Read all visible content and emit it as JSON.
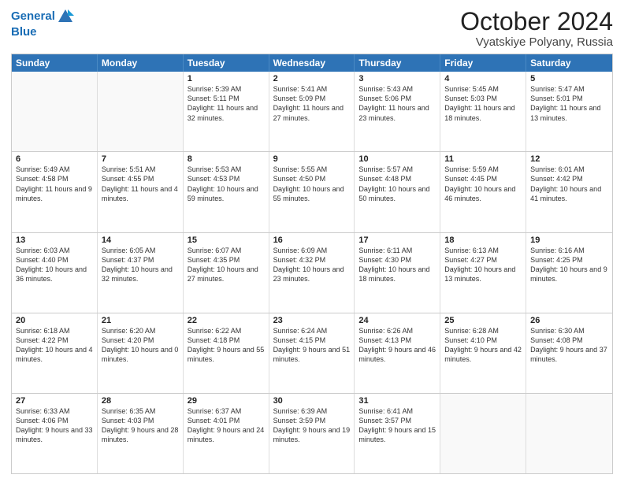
{
  "logo": {
    "line1": "General",
    "line2": "Blue"
  },
  "title": {
    "month": "October 2024",
    "location": "Vyatskiye Polyany, Russia"
  },
  "header_days": [
    "Sunday",
    "Monday",
    "Tuesday",
    "Wednesday",
    "Thursday",
    "Friday",
    "Saturday"
  ],
  "weeks": [
    [
      {
        "day": "",
        "sunrise": "",
        "sunset": "",
        "daylight": ""
      },
      {
        "day": "",
        "sunrise": "",
        "sunset": "",
        "daylight": ""
      },
      {
        "day": "1",
        "sunrise": "Sunrise: 5:39 AM",
        "sunset": "Sunset: 5:11 PM",
        "daylight": "Daylight: 11 hours and 32 minutes."
      },
      {
        "day": "2",
        "sunrise": "Sunrise: 5:41 AM",
        "sunset": "Sunset: 5:09 PM",
        "daylight": "Daylight: 11 hours and 27 minutes."
      },
      {
        "day": "3",
        "sunrise": "Sunrise: 5:43 AM",
        "sunset": "Sunset: 5:06 PM",
        "daylight": "Daylight: 11 hours and 23 minutes."
      },
      {
        "day": "4",
        "sunrise": "Sunrise: 5:45 AM",
        "sunset": "Sunset: 5:03 PM",
        "daylight": "Daylight: 11 hours and 18 minutes."
      },
      {
        "day": "5",
        "sunrise": "Sunrise: 5:47 AM",
        "sunset": "Sunset: 5:01 PM",
        "daylight": "Daylight: 11 hours and 13 minutes."
      }
    ],
    [
      {
        "day": "6",
        "sunrise": "Sunrise: 5:49 AM",
        "sunset": "Sunset: 4:58 PM",
        "daylight": "Daylight: 11 hours and 9 minutes."
      },
      {
        "day": "7",
        "sunrise": "Sunrise: 5:51 AM",
        "sunset": "Sunset: 4:55 PM",
        "daylight": "Daylight: 11 hours and 4 minutes."
      },
      {
        "day": "8",
        "sunrise": "Sunrise: 5:53 AM",
        "sunset": "Sunset: 4:53 PM",
        "daylight": "Daylight: 10 hours and 59 minutes."
      },
      {
        "day": "9",
        "sunrise": "Sunrise: 5:55 AM",
        "sunset": "Sunset: 4:50 PM",
        "daylight": "Daylight: 10 hours and 55 minutes."
      },
      {
        "day": "10",
        "sunrise": "Sunrise: 5:57 AM",
        "sunset": "Sunset: 4:48 PM",
        "daylight": "Daylight: 10 hours and 50 minutes."
      },
      {
        "day": "11",
        "sunrise": "Sunrise: 5:59 AM",
        "sunset": "Sunset: 4:45 PM",
        "daylight": "Daylight: 10 hours and 46 minutes."
      },
      {
        "day": "12",
        "sunrise": "Sunrise: 6:01 AM",
        "sunset": "Sunset: 4:42 PM",
        "daylight": "Daylight: 10 hours and 41 minutes."
      }
    ],
    [
      {
        "day": "13",
        "sunrise": "Sunrise: 6:03 AM",
        "sunset": "Sunset: 4:40 PM",
        "daylight": "Daylight: 10 hours and 36 minutes."
      },
      {
        "day": "14",
        "sunrise": "Sunrise: 6:05 AM",
        "sunset": "Sunset: 4:37 PM",
        "daylight": "Daylight: 10 hours and 32 minutes."
      },
      {
        "day": "15",
        "sunrise": "Sunrise: 6:07 AM",
        "sunset": "Sunset: 4:35 PM",
        "daylight": "Daylight: 10 hours and 27 minutes."
      },
      {
        "day": "16",
        "sunrise": "Sunrise: 6:09 AM",
        "sunset": "Sunset: 4:32 PM",
        "daylight": "Daylight: 10 hours and 23 minutes."
      },
      {
        "day": "17",
        "sunrise": "Sunrise: 6:11 AM",
        "sunset": "Sunset: 4:30 PM",
        "daylight": "Daylight: 10 hours and 18 minutes."
      },
      {
        "day": "18",
        "sunrise": "Sunrise: 6:13 AM",
        "sunset": "Sunset: 4:27 PM",
        "daylight": "Daylight: 10 hours and 13 minutes."
      },
      {
        "day": "19",
        "sunrise": "Sunrise: 6:16 AM",
        "sunset": "Sunset: 4:25 PM",
        "daylight": "Daylight: 10 hours and 9 minutes."
      }
    ],
    [
      {
        "day": "20",
        "sunrise": "Sunrise: 6:18 AM",
        "sunset": "Sunset: 4:22 PM",
        "daylight": "Daylight: 10 hours and 4 minutes."
      },
      {
        "day": "21",
        "sunrise": "Sunrise: 6:20 AM",
        "sunset": "Sunset: 4:20 PM",
        "daylight": "Daylight: 10 hours and 0 minutes."
      },
      {
        "day": "22",
        "sunrise": "Sunrise: 6:22 AM",
        "sunset": "Sunset: 4:18 PM",
        "daylight": "Daylight: 9 hours and 55 minutes."
      },
      {
        "day": "23",
        "sunrise": "Sunrise: 6:24 AM",
        "sunset": "Sunset: 4:15 PM",
        "daylight": "Daylight: 9 hours and 51 minutes."
      },
      {
        "day": "24",
        "sunrise": "Sunrise: 6:26 AM",
        "sunset": "Sunset: 4:13 PM",
        "daylight": "Daylight: 9 hours and 46 minutes."
      },
      {
        "day": "25",
        "sunrise": "Sunrise: 6:28 AM",
        "sunset": "Sunset: 4:10 PM",
        "daylight": "Daylight: 9 hours and 42 minutes."
      },
      {
        "day": "26",
        "sunrise": "Sunrise: 6:30 AM",
        "sunset": "Sunset: 4:08 PM",
        "daylight": "Daylight: 9 hours and 37 minutes."
      }
    ],
    [
      {
        "day": "27",
        "sunrise": "Sunrise: 6:33 AM",
        "sunset": "Sunset: 4:06 PM",
        "daylight": "Daylight: 9 hours and 33 minutes."
      },
      {
        "day": "28",
        "sunrise": "Sunrise: 6:35 AM",
        "sunset": "Sunset: 4:03 PM",
        "daylight": "Daylight: 9 hours and 28 minutes."
      },
      {
        "day": "29",
        "sunrise": "Sunrise: 6:37 AM",
        "sunset": "Sunset: 4:01 PM",
        "daylight": "Daylight: 9 hours and 24 minutes."
      },
      {
        "day": "30",
        "sunrise": "Sunrise: 6:39 AM",
        "sunset": "Sunset: 3:59 PM",
        "daylight": "Daylight: 9 hours and 19 minutes."
      },
      {
        "day": "31",
        "sunrise": "Sunrise: 6:41 AM",
        "sunset": "Sunset: 3:57 PM",
        "daylight": "Daylight: 9 hours and 15 minutes."
      },
      {
        "day": "",
        "sunrise": "",
        "sunset": "",
        "daylight": ""
      },
      {
        "day": "",
        "sunrise": "",
        "sunset": "",
        "daylight": ""
      }
    ]
  ]
}
